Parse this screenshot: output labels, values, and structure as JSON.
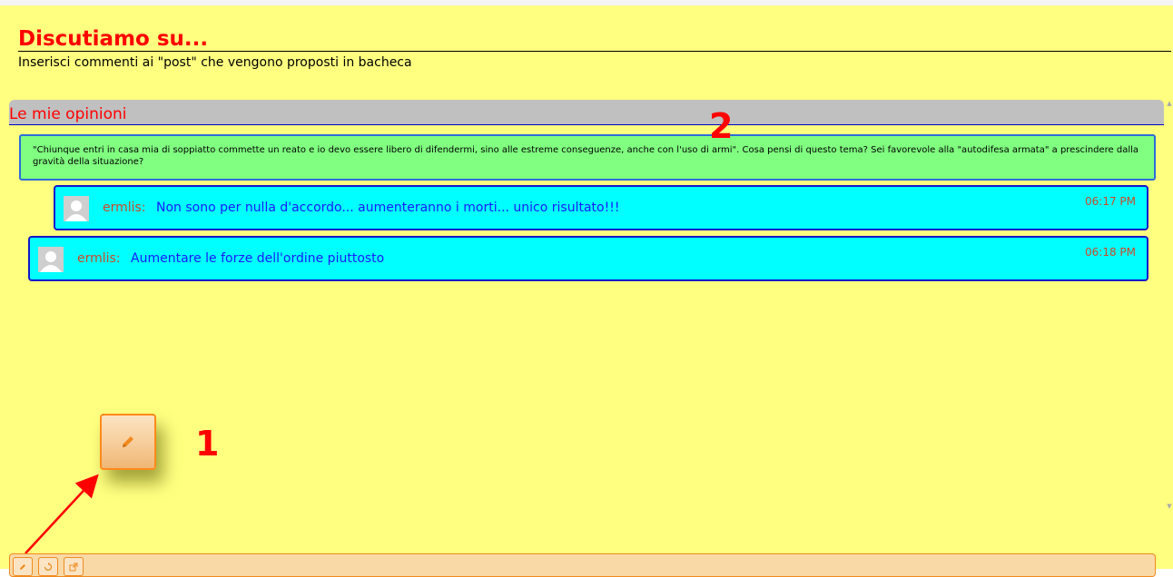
{
  "header": {
    "title": "Discutiamo su...",
    "subtitle": "Inserisci commenti ai \"post\" che vengono proposti in bacheca"
  },
  "section": {
    "title": "Le mie opinioni"
  },
  "post": {
    "text": "\"Chiunque entri in casa mia di soppiatto commette un reato e io devo essere libero di difendermi, sino alle estreme conseguenze, anche con l'uso di armi\". Cosa pensi di questo tema? Sei favorevole alla \"autodifesa armata\" a prescindere dalla gravità della situazione?"
  },
  "comments": [
    {
      "author": "ermlis:",
      "text": "Non sono per nulla d'accordo... aumenteranno i morti... unico risultato!!!",
      "time": "06:17 PM"
    },
    {
      "author": "ermlis:",
      "text": "Aumentare le forze dell'ordine piuttosto",
      "time": "06:18 PM"
    }
  ],
  "annotations": {
    "label_1": "1",
    "label_2": "2",
    "color": "#ff0000"
  },
  "toolbar": {
    "buttons": [
      {
        "icon": "pencil-icon"
      },
      {
        "icon": "refresh-icon"
      },
      {
        "icon": "external-link-icon"
      }
    ]
  },
  "colors": {
    "page_background": "#ffff80",
    "post_background": "#80ff80",
    "comment_background": "#00ffff",
    "accent_orange": "#f08a1e"
  }
}
